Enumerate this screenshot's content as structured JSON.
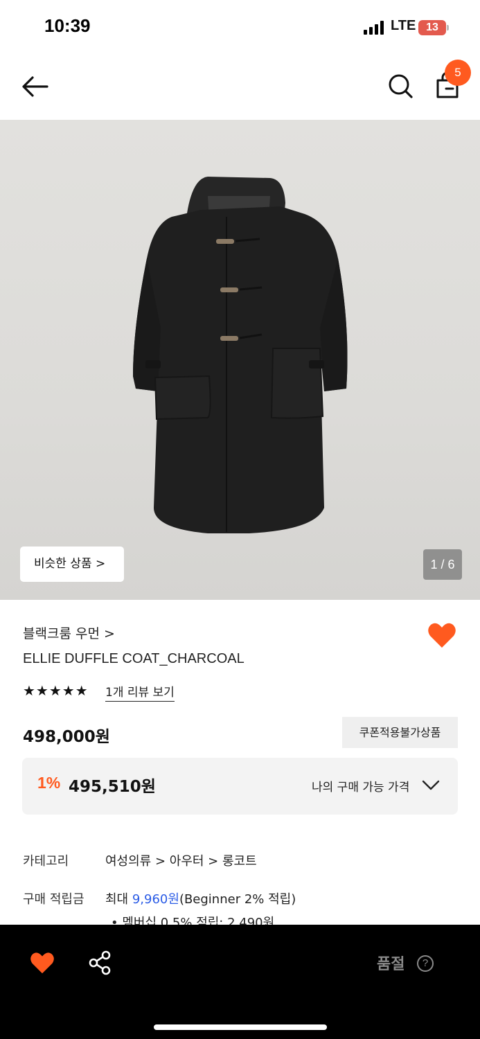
{
  "status": {
    "time": "10:39",
    "network": "LTE",
    "battery": "13"
  },
  "nav": {
    "cart_count": "5"
  },
  "image": {
    "similar_label": "비슷한 상품 >",
    "counter": "1 / 6"
  },
  "product": {
    "brand": "블랙크룸 우먼 >",
    "name": "ELLIE DUFFLE COAT_CHARCOAL",
    "stars": "★★★★★",
    "review_link": "1개 리뷰 보기",
    "price": "498,000원",
    "coupon_tag": "쿠폰적용불가상품"
  },
  "my_price": {
    "discount": "1%",
    "price": "495,510원",
    "label": "나의 구매 가능 가격"
  },
  "details": {
    "category_label": "카테고리",
    "category_path": "여성의류 > 아우터 > 롱코트",
    "points_label": "구매 적립금",
    "points_prefix": "최대 ",
    "points_value": "9,960원",
    "points_suffix": "(Beginner 2% 적립)",
    "member_line": "•  멤버십 0.5% 적립: 2,490원"
  },
  "bottom": {
    "status_label": "품절",
    "help_glyph": "?"
  },
  "colors": {
    "accent": "#ff5a1f",
    "link_blue": "#2b5ce6"
  }
}
